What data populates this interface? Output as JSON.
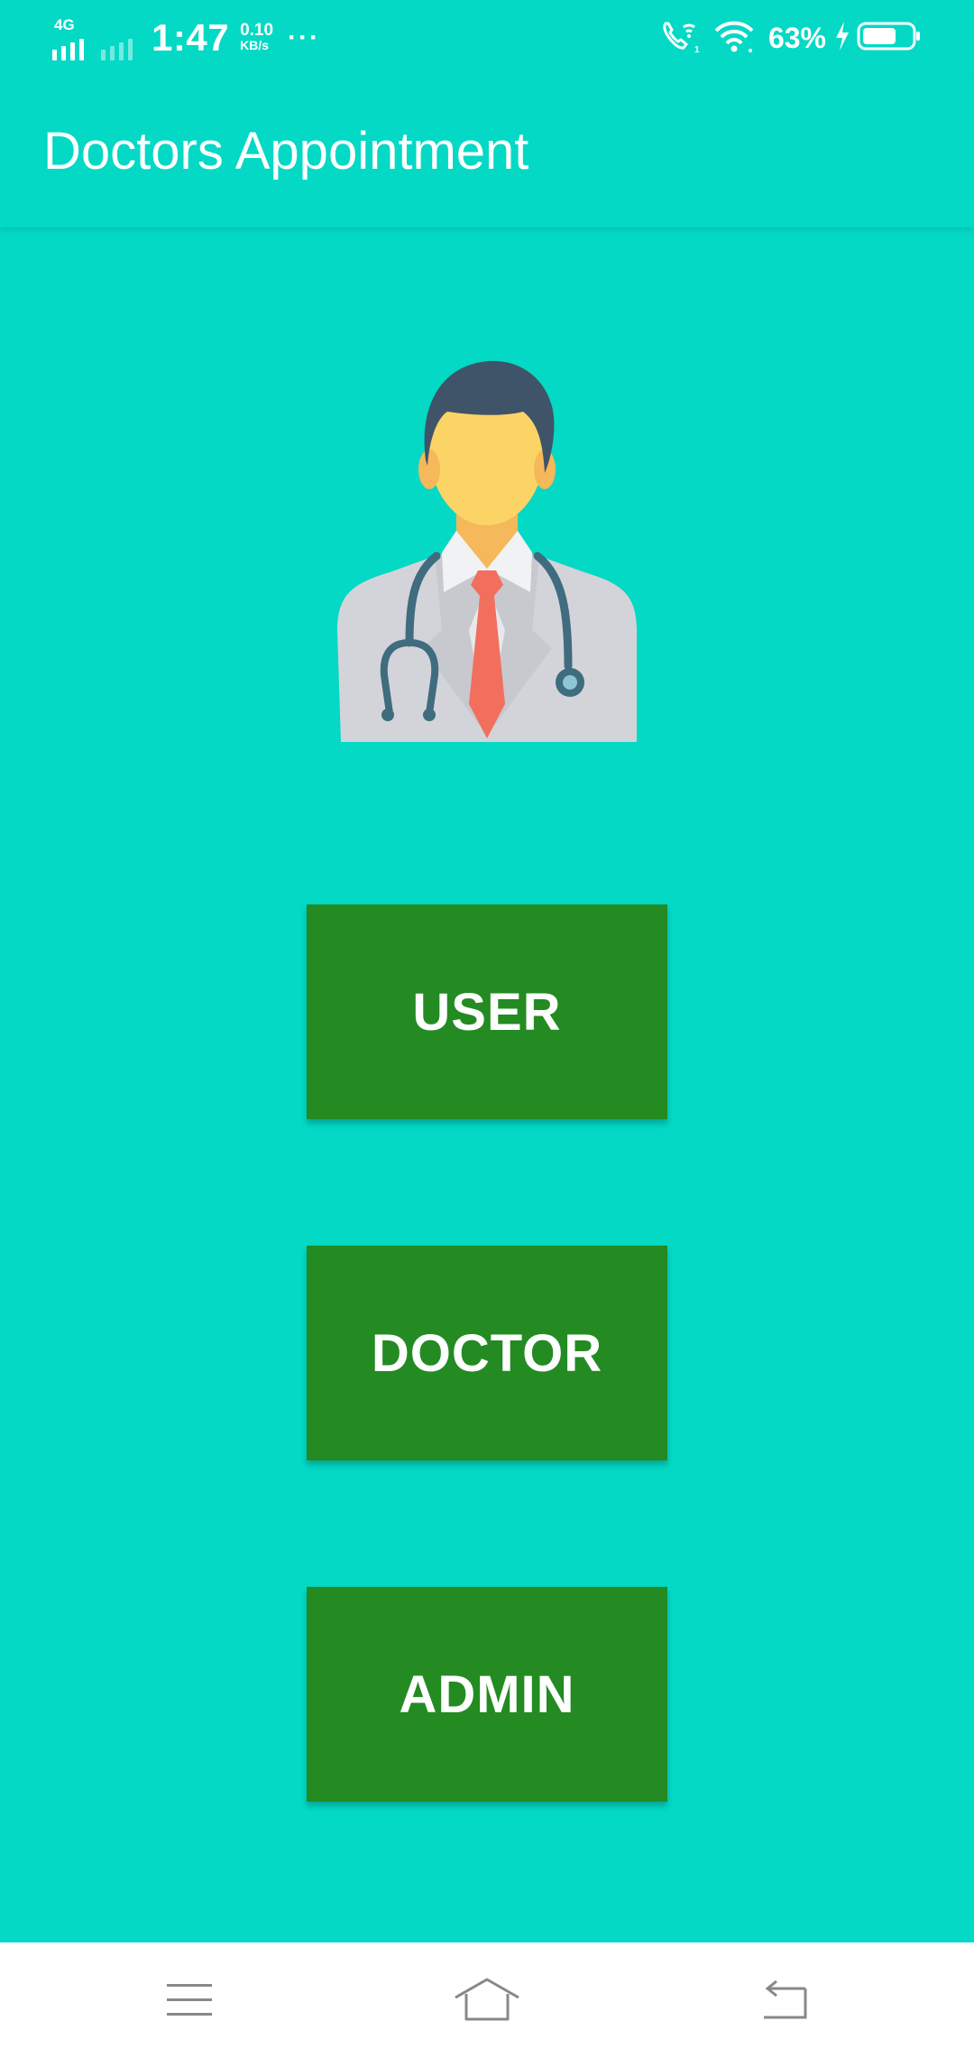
{
  "status_bar": {
    "network_type": "4G",
    "time": "1:47",
    "speed_value": "0.10",
    "speed_unit": "KB/s",
    "more_indicator": "···",
    "battery_percent": "63%",
    "icons": [
      "signal-icon",
      "secondary-signal-icon",
      "wifi-call-icon",
      "wifi-icon",
      "charging-icon",
      "battery-icon"
    ]
  },
  "app_bar": {
    "title": "Doctors Appointment"
  },
  "illustration": {
    "icon": "doctor-avatar-icon"
  },
  "buttons": {
    "user_label": "USER",
    "doctor_label": "DOCTOR",
    "admin_label": "ADMIN"
  },
  "nav_bar": {
    "icons": [
      "menu-icon",
      "home-icon",
      "back-icon"
    ]
  },
  "colors": {
    "background": "#03D9C5",
    "button": "#238B22",
    "button_text": "#FFFFFF",
    "nav_bar": "#FFFFFF"
  }
}
